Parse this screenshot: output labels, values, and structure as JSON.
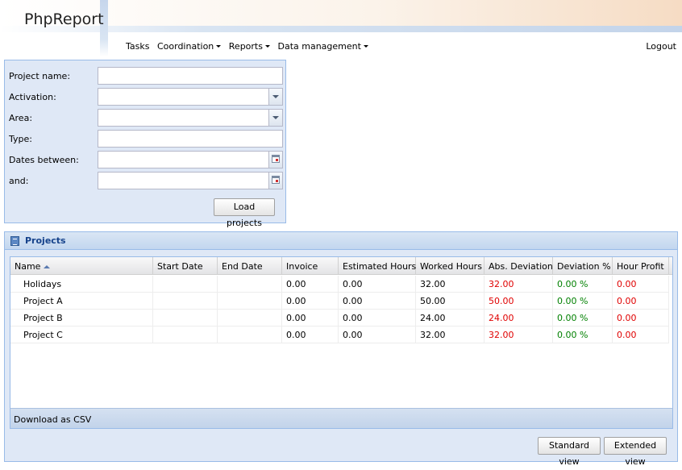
{
  "app": {
    "logo": "PhpReport"
  },
  "menu": {
    "items": [
      {
        "label": "Tasks",
        "dropdown": false
      },
      {
        "label": "Coordination",
        "dropdown": true
      },
      {
        "label": "Reports",
        "dropdown": true
      },
      {
        "label": "Data management",
        "dropdown": true
      }
    ],
    "logout": "Logout"
  },
  "filter": {
    "project_name_label": "Project name:",
    "activation_label": "Activation:",
    "area_label": "Area:",
    "type_label": "Type:",
    "dates_between_label": "Dates between:",
    "and_label": "and:",
    "project_name_value": "",
    "activation_value": "",
    "area_value": "",
    "type_value": "",
    "date_from_value": "",
    "date_to_value": "",
    "load_button": "Load projects"
  },
  "projects": {
    "title": "Projects",
    "columns": [
      "Name",
      "Start Date",
      "End Date",
      "Invoice",
      "Estimated Hours",
      "Worked Hours",
      "Abs. Deviation",
      "Deviation %",
      "Hour Profit"
    ],
    "sort": {
      "column": "Name",
      "direction": "ascending"
    },
    "rows": [
      {
        "name": "Holidays",
        "start": "",
        "end": "",
        "invoice": "0.00",
        "estimated": "0.00",
        "worked": "32.00",
        "abs_dev": "32.00",
        "dev_pct": "0.00 %",
        "hour_profit": "0.00"
      },
      {
        "name": "Project A",
        "start": "",
        "end": "",
        "invoice": "0.00",
        "estimated": "0.00",
        "worked": "50.00",
        "abs_dev": "50.00",
        "dev_pct": "0.00 %",
        "hour_profit": "0.00"
      },
      {
        "name": "Project B",
        "start": "",
        "end": "",
        "invoice": "0.00",
        "estimated": "0.00",
        "worked": "24.00",
        "abs_dev": "24.00",
        "dev_pct": "0.00 %",
        "hour_profit": "0.00"
      },
      {
        "name": "Project C",
        "start": "",
        "end": "",
        "invoice": "0.00",
        "estimated": "0.00",
        "worked": "32.00",
        "abs_dev": "32.00",
        "dev_pct": "0.00 %",
        "hour_profit": "0.00"
      }
    ],
    "download_csv": "Download as CSV",
    "standard_view": "Standard view",
    "extended_view": "Extended view"
  },
  "colors": {
    "negative": "#e00000",
    "positive": "#008000",
    "panel_bg": "#dfe8f6",
    "panel_border": "#99bbe8"
  }
}
